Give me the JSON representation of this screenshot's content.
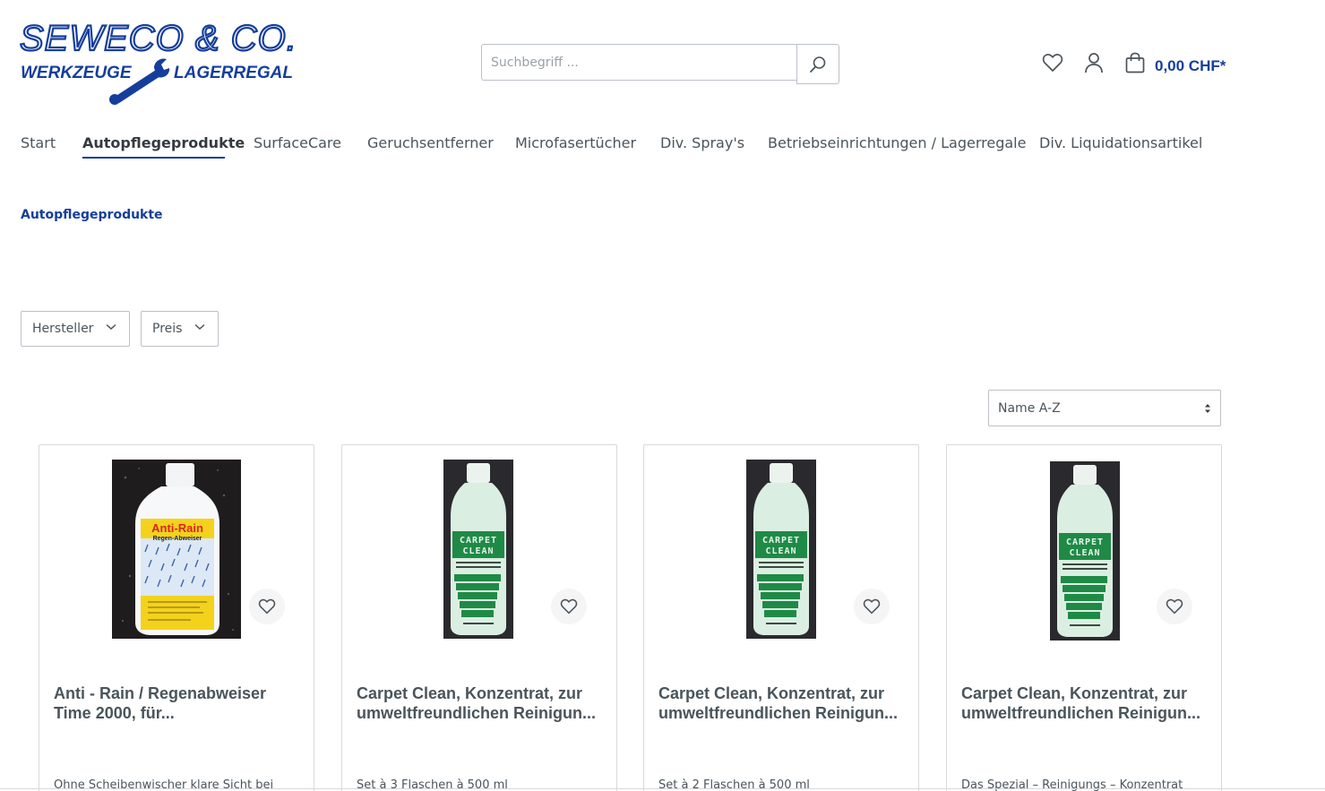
{
  "header": {
    "logo": {
      "line1": "SEWECO & CO.",
      "left_word": "WERKZEUGE",
      "right_word": "LAGERREGALE",
      "color": "#153e9c"
    },
    "search": {
      "placeholder": "Suchbegriff ...",
      "icon": "search-icon"
    },
    "icons": {
      "wishlist": "heart-icon",
      "account": "user-icon",
      "cart": "bag-icon"
    },
    "cart_total": "0,00 CHF*"
  },
  "nav": {
    "items": [
      {
        "label": "Start"
      },
      {
        "label": "Autopflegeprodukte",
        "active": true
      },
      {
        "label": "SurfaceCare"
      },
      {
        "label": "Geruchsentferner"
      },
      {
        "label": "Microfasertücher"
      },
      {
        "label": "Div. Spray's"
      },
      {
        "label": "Betriebseinrichtungen / Lagerregale"
      },
      {
        "label": "Div. Liquidationsartikel"
      }
    ]
  },
  "breadcrumb": "Autopflegeprodukte",
  "filters": [
    {
      "label": "Hersteller"
    },
    {
      "label": "Preis"
    }
  ],
  "sorting": {
    "selected": "Name A-Z"
  },
  "products": [
    {
      "title": "Anti - Rain / Regenabweiser Time 2000, für...",
      "description": "Ohne Scheibenwischer klare Sicht bei",
      "label_top": "Anti-Rain",
      "label_sub": "Regen-Abweiser"
    },
    {
      "title": "Carpet Clean, Konzentrat, zur umweltfreundlichen Reinigun...",
      "description": "Set à 3 Flaschen à 500 ml",
      "label_top": "CARPET",
      "label_sub": "CLEAN"
    },
    {
      "title": "Carpet Clean, Konzentrat, zur umweltfreundlichen Reinigun...",
      "description": "Set à 2 Flaschen à 500 ml",
      "label_top": "CARPET",
      "label_sub": "CLEAN"
    },
    {
      "title": "Carpet Clean, Konzentrat, zur umweltfreundlichen Reinigun...",
      "description": "Das Spezial – Reinigungs – Konzentrat",
      "label_top": "CARPET",
      "label_sub": "CLEAN"
    }
  ],
  "colors": {
    "brand": "#153e9c",
    "text": "#4a545b",
    "border": "#bcc1c7"
  }
}
